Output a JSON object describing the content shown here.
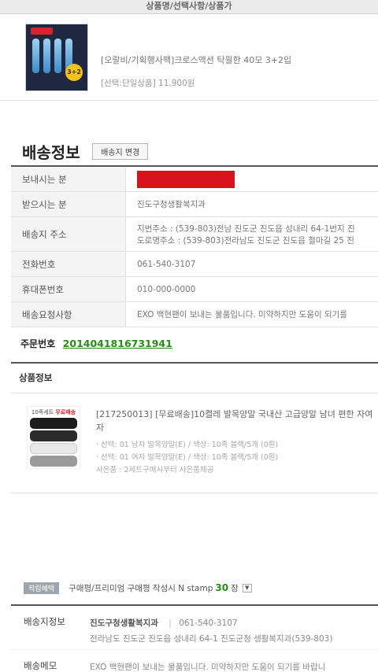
{
  "header": {
    "title": "상품명/선택사항/상품가"
  },
  "product": {
    "name": "[오랄비/기획행사팩]크로스액션 탁월한 40모 3+2입",
    "option": "[선택:단일상품] 11,900원",
    "thumb_badge": "3+2"
  },
  "shipping": {
    "title": "배송정보",
    "change_button": "배송지 변경",
    "rows": [
      {
        "label": "보내시는 분",
        "value": ""
      },
      {
        "label": "받으시는 분",
        "value": "진도구청생활복지과"
      },
      {
        "label": "배송지 주소",
        "line1": "지번주소 : (539-803)전남 진도군 진도읍 성내리 64-1번지 진",
        "line2": "도로명주소 : (539-803)전라남도 진도군 진도읍 철마길 25 진"
      },
      {
        "label": "전화번호",
        "value": "061-540-3107"
      },
      {
        "label": "휴대폰번호",
        "value": "010-000-0000"
      },
      {
        "label": "배송요청사항",
        "value": "EXO 백현팬이 보내는 물품입니다. 미약하지만 도움이 되기를"
      }
    ]
  },
  "order": {
    "label": "주문번호",
    "number": "2014041816731941"
  },
  "product_info": {
    "title": "상품정보",
    "thumb_label_a": "10족세트",
    "thumb_label_b": "무료배송",
    "desc": "[217250013] [무료배송]10켤레 발목양말 국내산 고급양말 남녀 편한 자여자",
    "opt1": "· 선택: 01 남자 발목양말(E) / 색상: 10족 블랙/5개 (0원)",
    "opt2": "· 선택: 01 여자 발목양말(E) / 색상: 10족 블랙/5개 (0원)",
    "opt3": "사은품 : 2세트구매시부터 사은품제공"
  },
  "points": {
    "badge": "적립혜택",
    "text": "구매평/프리미엄 구매평 작성시 N stamp",
    "count": "30",
    "unit": "장"
  },
  "bottom": {
    "ship_label": "배송지정보",
    "recipient": "진도구청생활복지과",
    "phone": "061-540-3107",
    "address": "전라남도 진도군 진도읍 성내리 64-1 진도군청 생활복지과(539-803)",
    "memo_label": "배송메모",
    "memo": "EXO 백현팬이 보내는 물품입니다. 미약하지만 도움이 되기를 바랍니"
  },
  "colors": {
    "accent_green": "#2a8a1a",
    "redaction": "#d8121b",
    "brand_red": "#d8232a"
  }
}
